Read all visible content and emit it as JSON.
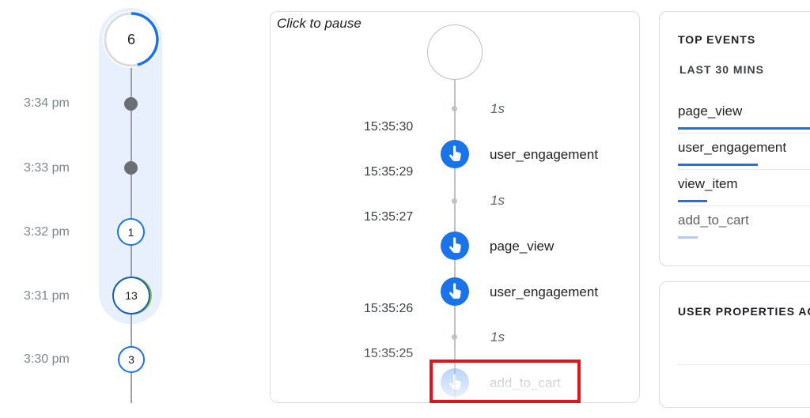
{
  "minute_timeline": {
    "current": {
      "count": "6"
    },
    "rows": [
      {
        "time": "3:34 pm",
        "count": ""
      },
      {
        "time": "3:33 pm",
        "count": ""
      },
      {
        "time": "3:32 pm",
        "count": "1"
      },
      {
        "time": "3:31 pm",
        "count": "13"
      },
      {
        "time": "3:30 pm",
        "count": "3"
      }
    ]
  },
  "stream": {
    "pause_hint": "Click to pause",
    "times": [
      "15:35:30",
      "15:35:29",
      "15:35:27",
      "15:35:26",
      "15:35:25"
    ],
    "gaps": [
      "1s",
      "1s",
      "1s"
    ],
    "events": [
      {
        "name": "user_engagement",
        "icon": "touch-icon"
      },
      {
        "name": "page_view",
        "icon": "touch-icon"
      },
      {
        "name": "user_engagement",
        "icon": "touch-icon"
      },
      {
        "name": "add_to_cart",
        "icon": "touch-icon"
      }
    ]
  },
  "top_events": {
    "heading": "TOP EVENTS",
    "subheading": "LAST 30 MINS",
    "items": [
      {
        "name": "page_view",
        "share": 1.0
      },
      {
        "name": "user_engagement",
        "share": 0.57
      },
      {
        "name": "view_item",
        "share": 0.21
      },
      {
        "name": "add_to_cart",
        "share": 0.14
      }
    ]
  },
  "user_properties": {
    "heading": "USER PROPERTIES AC"
  },
  "colors": {
    "accent": "#1a73e8",
    "highlight_bg": "#e8f0fe",
    "annotation_red": "#e2141b"
  }
}
